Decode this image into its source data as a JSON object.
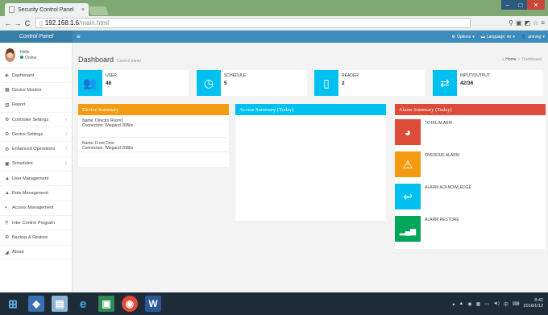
{
  "browser": {
    "tab_title": "Security Control Panel",
    "tab_close": "×",
    "url_host": "192.168.1.6",
    "url_path": "/main.html",
    "colors": {
      "frame": "#7fa873",
      "minmax": "#2d5a7d",
      "close": "#c9473a"
    }
  },
  "appbar": {
    "brand": "Control Panel",
    "menu_toggle": "≡",
    "options": "Options",
    "language": "Language: en",
    "user": "anming",
    "color": "#3c8dbc"
  },
  "sidebar": {
    "hello": "Hello",
    "status": "Online",
    "items": [
      {
        "label": "Dashboard",
        "icon": "dashboard-icon",
        "glyph": "◈",
        "caret": ""
      },
      {
        "label": "Device Monitor",
        "icon": "monitor-icon",
        "glyph": "▦",
        "caret": ""
      },
      {
        "label": "Report",
        "icon": "report-icon",
        "glyph": "▥",
        "caret": ""
      },
      {
        "label": "Controller Settings",
        "icon": "settings-icon",
        "glyph": "⚙",
        "caret": "‹"
      },
      {
        "label": "Device Settings",
        "icon": "settings-icon",
        "glyph": "⚙",
        "caret": "‹"
      },
      {
        "label": "Enhanced Operations",
        "icon": "settings-icon",
        "glyph": "⚙",
        "caret": "‹"
      },
      {
        "label": "Schedules",
        "icon": "calendar-icon",
        "glyph": "▣",
        "caret": "‹"
      },
      {
        "label": "User Management",
        "icon": "user-icon",
        "glyph": "▲",
        "caret": ""
      },
      {
        "label": "Role Management",
        "icon": "role-icon",
        "glyph": "▲",
        "caret": ""
      },
      {
        "label": "Access Management",
        "icon": "access-icon",
        "glyph": "◐",
        "caret": ""
      },
      {
        "label": "Inter Control Program",
        "icon": "program-icon",
        "glyph": "⚲",
        "caret": ""
      },
      {
        "label": "Backup & Restore",
        "icon": "backup-icon",
        "glyph": "⚙",
        "caret": ""
      },
      {
        "label": "About",
        "icon": "about-icon",
        "glyph": "◢",
        "caret": ""
      }
    ]
  },
  "header": {
    "title": "Dashboard",
    "subtitle": "Control panel",
    "breadcrumb_home": "Home",
    "breadcrumb_current": "Dashboard"
  },
  "infoboxes": [
    {
      "label": "User",
      "value": "46",
      "icon": "users-icon",
      "glyph": "👥",
      "color": "#00c0ef"
    },
    {
      "label": "Schedule",
      "value": "5",
      "icon": "clock-icon",
      "glyph": "◷",
      "color": "#00c0ef"
    },
    {
      "label": "Reader",
      "value": "2",
      "icon": "mobile-icon",
      "glyph": "▯",
      "color": "#00c0ef"
    },
    {
      "label": "Input/Output",
      "value": "42/36",
      "icon": "exchange-icon",
      "glyph": "⇄",
      "color": "#00c0ef"
    }
  ],
  "panels": {
    "device_summary": {
      "title": "Device Summary",
      "color": "#f39c12",
      "devices": [
        {
          "name": "Name: Director Room1",
          "connection": "Connection: Wiegand 26Bits"
        },
        {
          "name": "Name: Front Door",
          "connection": "Connection: Wiegand 26Bits"
        }
      ]
    },
    "access_summary": {
      "title": "Access Summary (Today)",
      "color": "#00c0ef"
    },
    "alarm_summary": {
      "title": "Alarm Summary (Today)",
      "color": "#dd4b39",
      "items": [
        {
          "label": "Total Alarm",
          "icon": "pie-chart-icon",
          "glyph": "◕",
          "color": "#dd4b39"
        },
        {
          "label": "Overdue Alarm",
          "icon": "warning-icon",
          "glyph": "⚠",
          "color": "#f39c12"
        },
        {
          "label": "Alarm Acknowledge",
          "icon": "reply-icon",
          "glyph": "↩",
          "color": "#00c0ef"
        },
        {
          "label": "Alarm Restore",
          "icon": "signal-icon",
          "glyph": "▂▄▆",
          "color": "#00a65a"
        }
      ]
    }
  },
  "taskbar": {
    "time": "8:42",
    "date": "2016/1/12"
  }
}
